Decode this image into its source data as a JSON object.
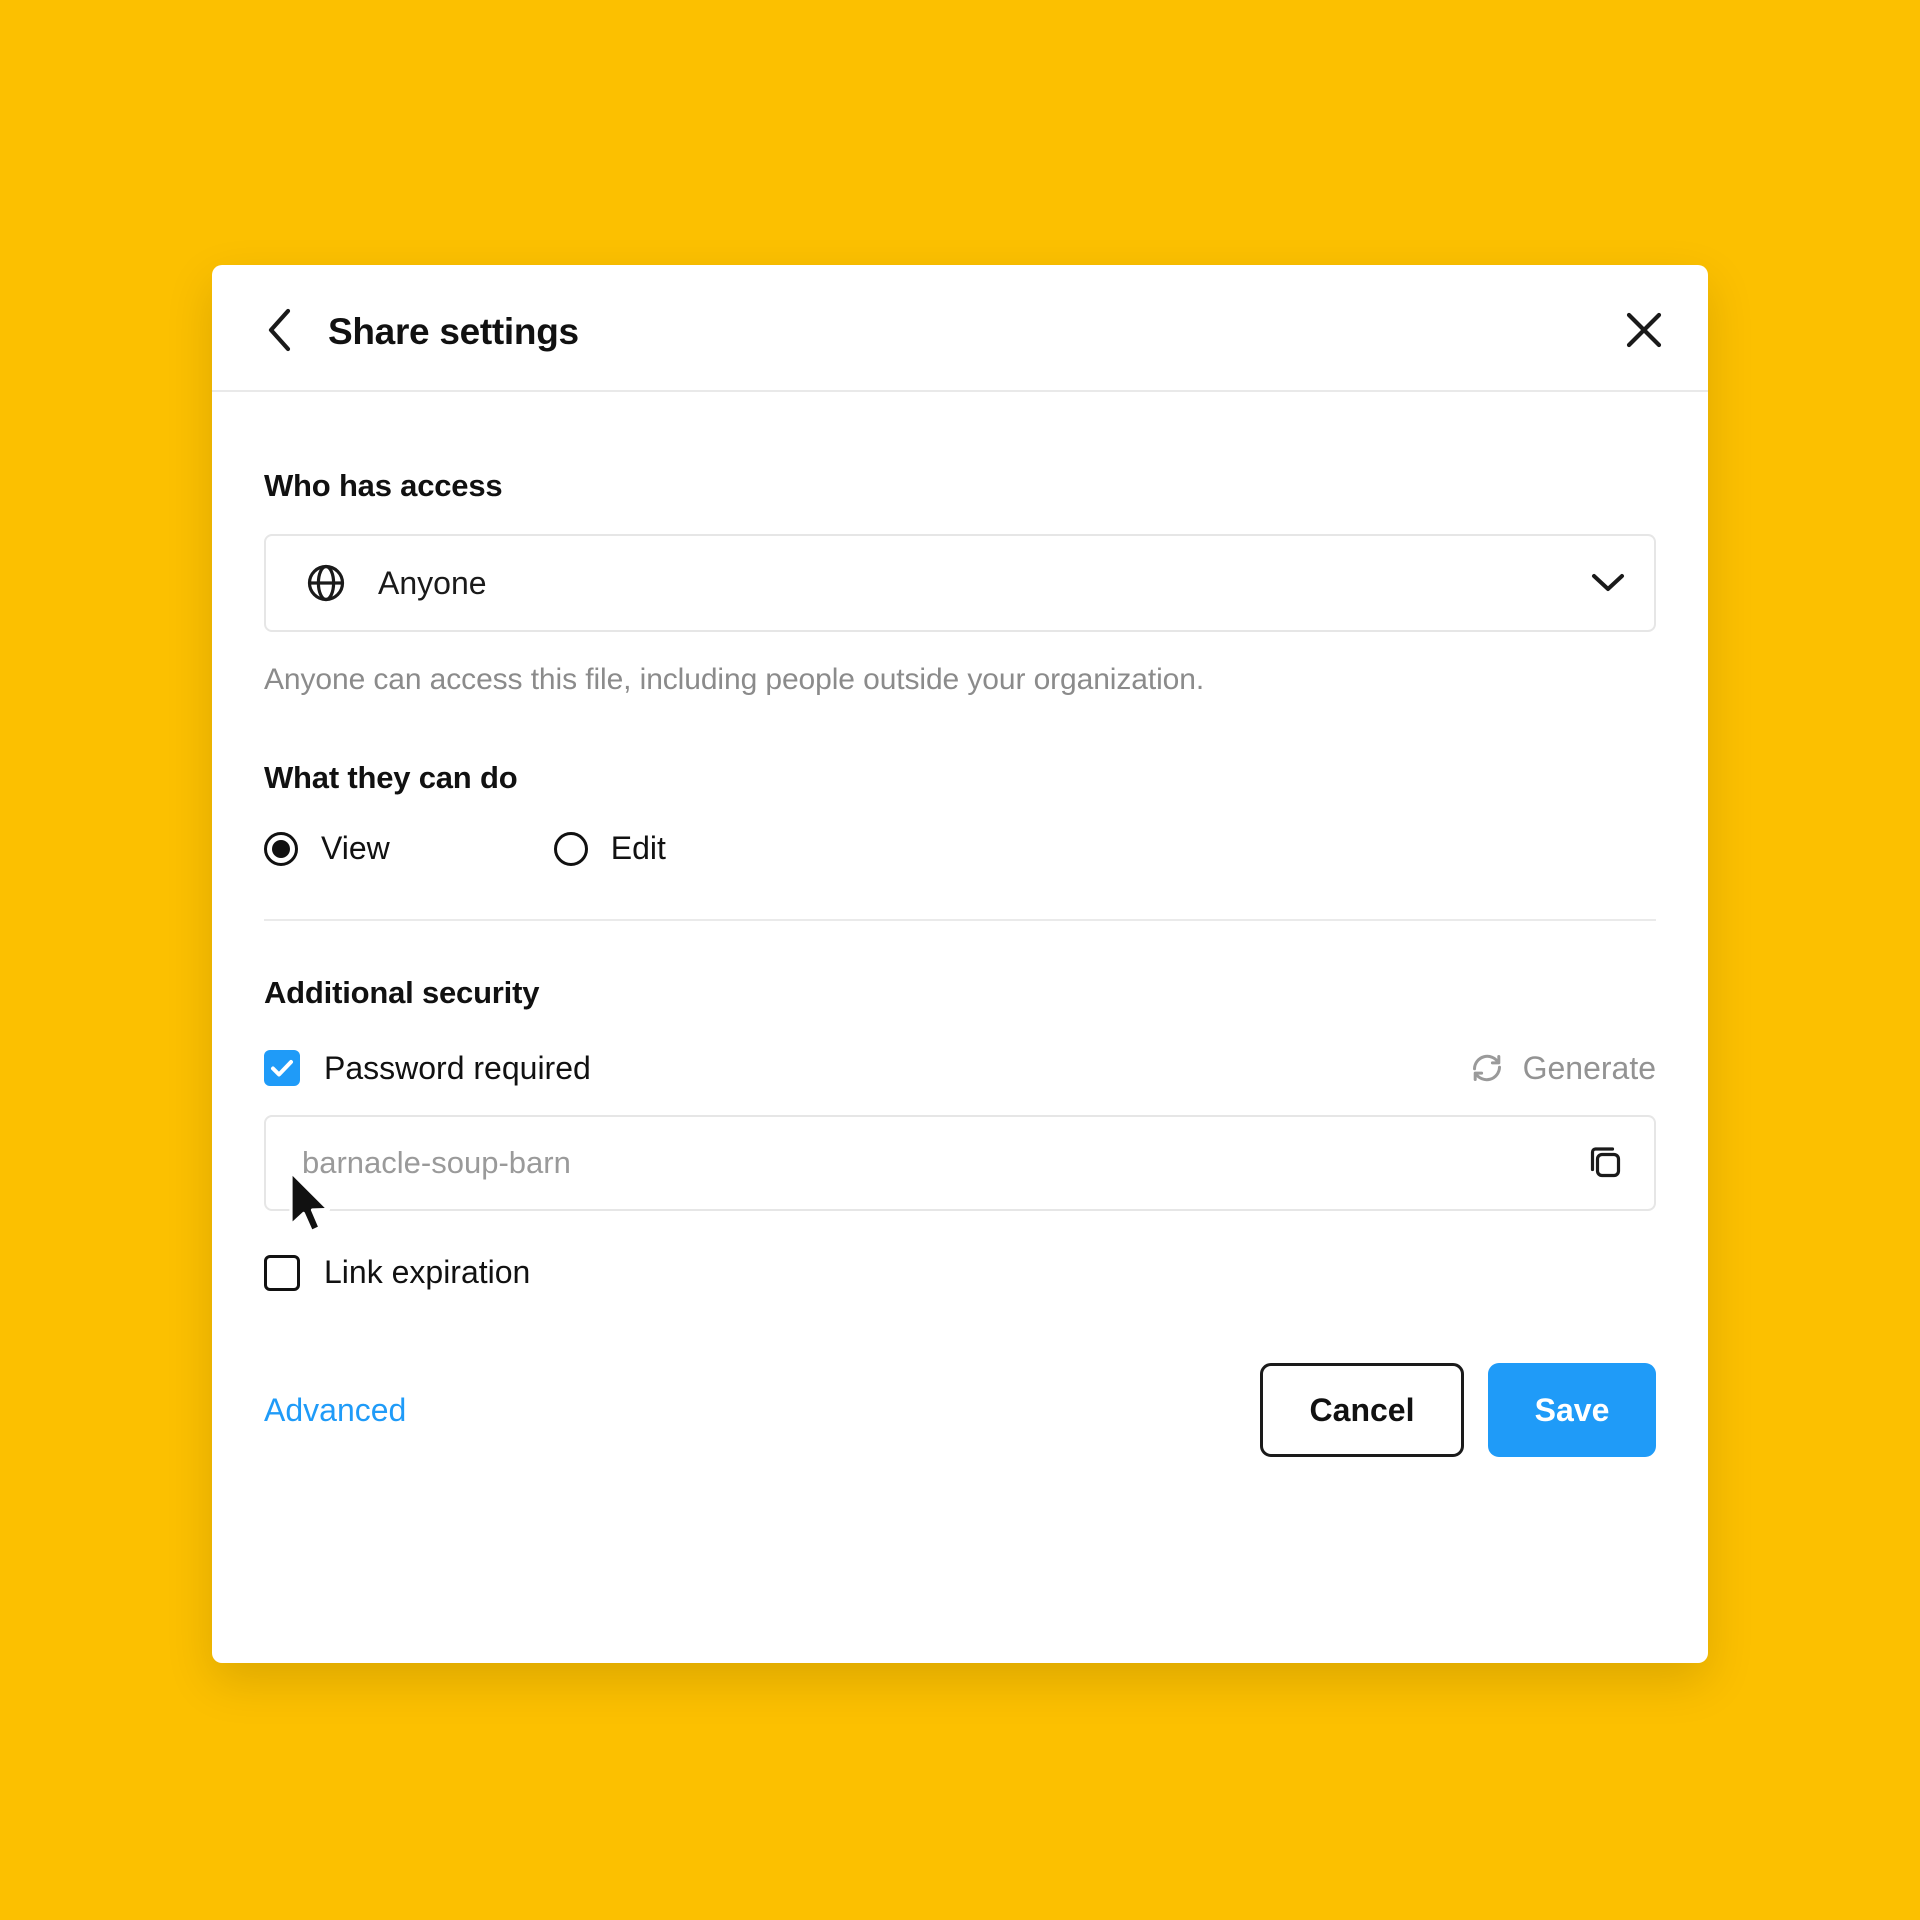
{
  "background_color": "#FCC000",
  "accent_color": "#1f9bf8",
  "header": {
    "title": "Share settings",
    "back_icon": "chevron-left-icon",
    "close_icon": "close-icon"
  },
  "who_has_access": {
    "label": "Who has access",
    "select": {
      "icon": "globe-icon",
      "value": "Anyone",
      "chevron_icon": "chevron-down-icon",
      "options": [
        "Anyone"
      ]
    },
    "hint": "Anyone can access this file, including people outside your organization."
  },
  "what_they_can_do": {
    "label": "What they can do",
    "options": [
      {
        "label": "View",
        "selected": true
      },
      {
        "label": "Edit",
        "selected": false
      }
    ]
  },
  "additional_security": {
    "label": "Additional security",
    "password": {
      "checkbox_label": "Password required",
      "checked": true,
      "generate_label": "Generate",
      "generate_icon": "refresh-icon",
      "placeholder": "barnacle-soup-barn",
      "value": "",
      "copy_icon": "copy-icon"
    },
    "link_expiration": {
      "checkbox_label": "Link expiration",
      "checked": false
    }
  },
  "footer": {
    "advanced_label": "Advanced",
    "cancel_label": "Cancel",
    "save_label": "Save"
  },
  "cursor": {
    "icon": "mouse-pointer-icon"
  }
}
